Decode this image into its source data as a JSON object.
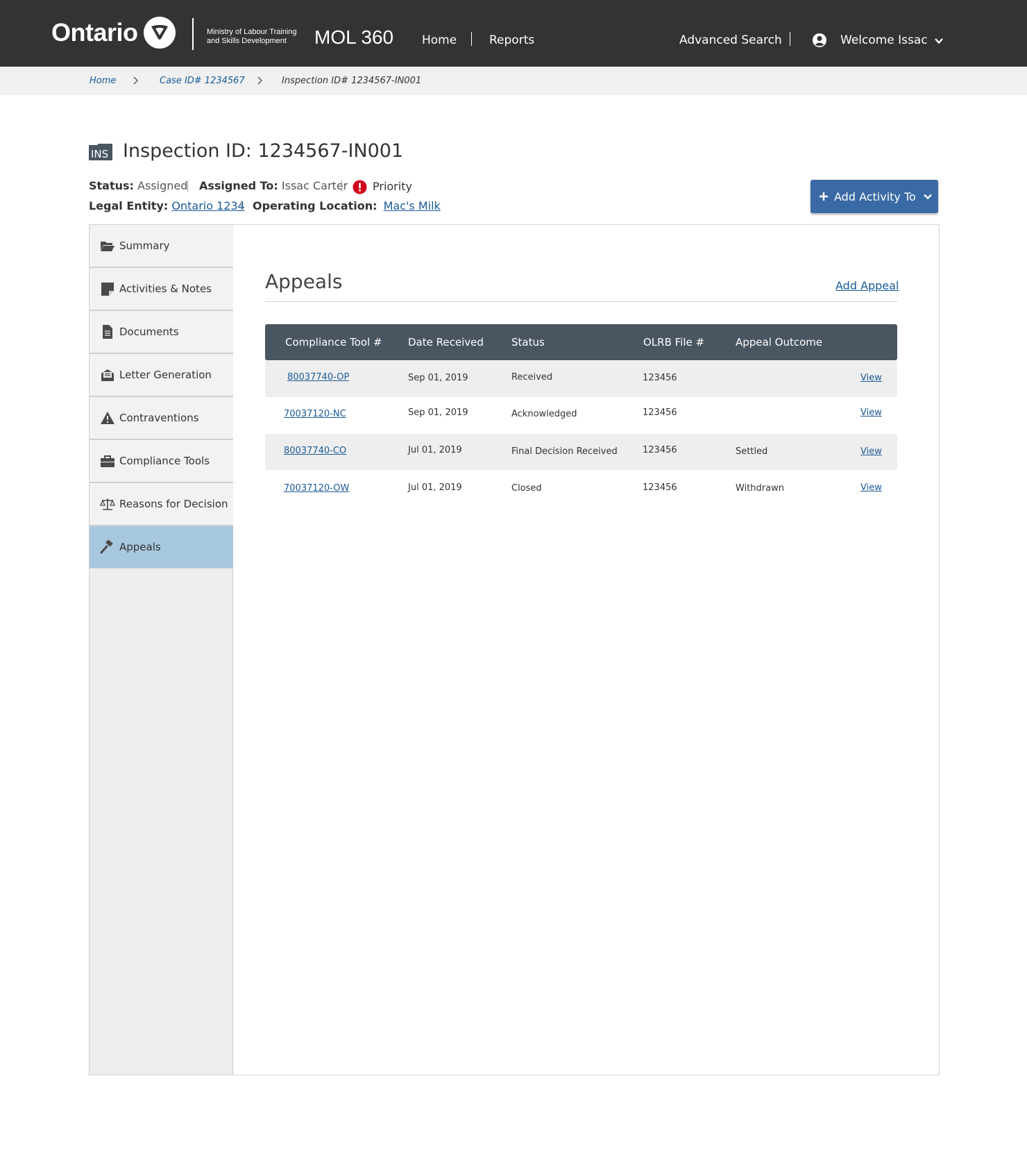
{
  "header": {
    "logo_text": "Ontario",
    "ministry_line1": "Ministry of Labour Training",
    "ministry_line2": "and Skills Development",
    "app_name": "MOL 360",
    "nav_home": "Home",
    "nav_reports": "Reports",
    "advanced_search": "Advanced Search",
    "welcome": "Welcome Issac"
  },
  "breadcrumb": {
    "home": "Home",
    "case": "Case ID# 1234567",
    "current": "Inspection ID# 1234567-IN001"
  },
  "record": {
    "badge": "INS",
    "title": "Inspection ID: 1234567-IN001",
    "status_label": "Status:",
    "status_value": "Assigned",
    "assigned_label": "Assigned To:",
    "assigned_value": "Issac Carter",
    "priority": "Priority",
    "legal_entity_label": "Legal Entity:",
    "legal_entity_value": "Ontario 1234",
    "operating_location_label": "Operating Location:",
    "operating_location_value": "Mac's Milk",
    "add_activity": "Add Activity To"
  },
  "sidebar": {
    "items": [
      {
        "label": "Summary",
        "icon": "folder-open-icon"
      },
      {
        "label": "Activities & Notes",
        "icon": "sticky-note-icon"
      },
      {
        "label": "Documents",
        "icon": "document-icon"
      },
      {
        "label": "Letter Generation",
        "icon": "envelope-open-icon"
      },
      {
        "label": "Contraventions",
        "icon": "warning-icon"
      },
      {
        "label": "Compliance Tools",
        "icon": "toolbox-icon"
      },
      {
        "label": "Reasons for Decision",
        "icon": "balance-scale-icon"
      },
      {
        "label": "Appeals",
        "icon": "gavel-icon",
        "active": true
      }
    ]
  },
  "appeals": {
    "title": "Appeals",
    "add_link": "Add Appeal",
    "columns": [
      "Compliance Tool #",
      "Date Received",
      "Status",
      "OLRB File #",
      "Appeal Outcome"
    ],
    "rows": [
      {
        "tool": "80037740-OP",
        "date": "Sep 01, 2019",
        "status": "Received",
        "file": "123456",
        "outcome": "",
        "action": "View"
      },
      {
        "tool": "70037120-NC",
        "date": "Sep 01, 2019",
        "status": "Acknowledged",
        "file": "123456",
        "outcome": "",
        "action": "View"
      },
      {
        "tool": "80037740-CO",
        "date": "Jul 01, 2019",
        "status": "Final Decision Received",
        "file": "123456",
        "outcome": "Settled",
        "action": "View"
      },
      {
        "tool": "70037120-OW",
        "date": "Jul 01, 2019",
        "status": "Closed",
        "file": "123456",
        "outcome": "Withdrawn",
        "action": "View"
      }
    ]
  },
  "colors": {
    "header_bg": "#333333",
    "link": "#1a5a96",
    "primary_button": "#3a6aa5",
    "table_header": "#4a5562",
    "active_nav": "#a8c8e0",
    "priority": "#d0021b"
  }
}
